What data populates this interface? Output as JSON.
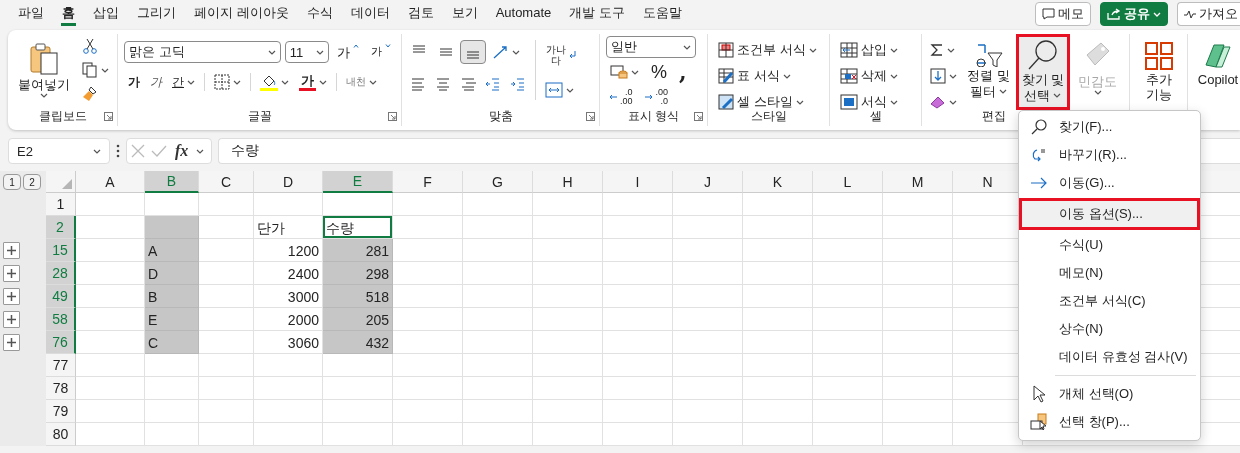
{
  "tabs": [
    {
      "label": "파일",
      "selected": false
    },
    {
      "label": "홈",
      "selected": true
    },
    {
      "label": "삽입",
      "selected": false
    },
    {
      "label": "그리기",
      "selected": false
    },
    {
      "label": "페이지 레이아웃",
      "selected": false
    },
    {
      "label": "수식",
      "selected": false
    },
    {
      "label": "데이터",
      "selected": false
    },
    {
      "label": "검토",
      "selected": false
    },
    {
      "label": "보기",
      "selected": false
    },
    {
      "label": "Automate",
      "selected": false
    },
    {
      "label": "개발 도구",
      "selected": false
    },
    {
      "label": "도움말",
      "selected": false
    }
  ],
  "header_buttons": [
    {
      "label": "메모",
      "kind": "comment"
    },
    {
      "label": "공유",
      "kind": "share"
    },
    {
      "label": "가져오",
      "kind": "import"
    }
  ],
  "ribbon": {
    "groups": [
      {
        "kind": "clipboard",
        "label": "클립보드",
        "paste": "붙여넣기"
      },
      {
        "kind": "font",
        "label": "글꼴",
        "font_name": "맑은 고딕",
        "font_size": "11",
        "grow": "가",
        "shrink": "가",
        "bold": "가",
        "italic": "가",
        "underline": "간",
        "font_color": "가",
        "phonetic": "내천"
      },
      {
        "kind": "alignment",
        "label": "맞춤",
        "vertical": [
          {
            "selected": false
          },
          {
            "selected": false
          },
          {
            "selected": true
          }
        ],
        "wrap": "가나다"
      },
      {
        "kind": "number",
        "label": "표시 형식",
        "format": "일반",
        "percent": "%",
        "comma": ",",
        "increase_decimal": [
          ".0",
          ".00"
        ],
        "decrease_decimal": [
          ".00",
          ".0"
        ]
      },
      {
        "kind": "styles",
        "label": "스타일",
        "items": [
          "조건부 서식",
          "표 서식",
          "셀 스타일"
        ]
      },
      {
        "kind": "cells",
        "label": "셀",
        "items": [
          "삽입",
          "삭제",
          "서식"
        ]
      },
      {
        "kind": "editing",
        "label": "편집",
        "sort": [
          "정렬 및",
          "필터"
        ],
        "find": [
          "찾기 및",
          "선택"
        ],
        "find_selected": true
      },
      {
        "kind": "sensitivity",
        "label": "민감도",
        "disabled": true
      },
      {
        "kind": "addins",
        "label": [
          "추가",
          "기능"
        ]
      },
      {
        "kind": "copilot",
        "label": "Copilot"
      }
    ]
  },
  "formula_bar": {
    "name_box": "E2",
    "fx": "fx",
    "formula": "수량"
  },
  "outline_levels": [
    "1",
    "2"
  ],
  "columns": [
    {
      "letter": "A",
      "selected": false,
      "active": false
    },
    {
      "letter": "B",
      "selected": true,
      "active": false
    },
    {
      "letter": "C",
      "selected": false,
      "active": false
    },
    {
      "letter": "D",
      "selected": false,
      "active": false
    },
    {
      "letter": "E",
      "selected": true,
      "active": true
    },
    {
      "letter": "F",
      "selected": false,
      "active": false
    },
    {
      "letter": "G",
      "selected": false,
      "active": false
    },
    {
      "letter": "H",
      "selected": false,
      "active": false
    },
    {
      "letter": "I",
      "selected": false,
      "active": false
    },
    {
      "letter": "J",
      "selected": false,
      "active": false
    },
    {
      "letter": "K",
      "selected": false,
      "active": false
    },
    {
      "letter": "L",
      "selected": false,
      "active": false
    },
    {
      "letter": "M",
      "selected": false,
      "active": false
    },
    {
      "letter": "N",
      "selected": false,
      "active": false
    }
  ],
  "rows": [
    {
      "header": "1",
      "selected": false,
      "active": false,
      "collapsed": false
    },
    {
      "header": "2",
      "selected": true,
      "active": true,
      "collapsed": false,
      "column_d": "단가",
      "column_e": "수량"
    },
    {
      "header": "15",
      "selected": true,
      "active": false,
      "collapsed": true,
      "column_b": "A",
      "column_d": "1200",
      "column_e": "281"
    },
    {
      "header": "28",
      "selected": true,
      "active": false,
      "collapsed": true,
      "column_b": "D",
      "column_d": "2400",
      "column_e": "298"
    },
    {
      "header": "49",
      "selected": true,
      "active": false,
      "collapsed": true,
      "column_b": "B",
      "column_d": "3000",
      "column_e": "518"
    },
    {
      "header": "58",
      "selected": true,
      "active": false,
      "collapsed": true,
      "column_b": "E",
      "column_d": "2000",
      "column_e": "205"
    },
    {
      "header": "76",
      "selected": true,
      "active": false,
      "collapsed": true,
      "column_b": "C",
      "column_d": "3060",
      "column_e": "432"
    },
    {
      "header": "77",
      "selected": false,
      "active": false,
      "collapsed": false
    },
    {
      "header": "78",
      "selected": false,
      "active": false,
      "collapsed": false
    },
    {
      "header": "79",
      "selected": false,
      "active": false,
      "collapsed": false
    },
    {
      "header": "80",
      "selected": false,
      "active": false,
      "collapsed": false
    }
  ],
  "menu": {
    "items": [
      {
        "label": "찾기(F)...",
        "selected": false
      },
      {
        "label": "바꾸기(R)...",
        "selected": false
      },
      {
        "label": "이동(G)...",
        "selected": false
      },
      {
        "label": "이동 옵션(S)...",
        "selected": true
      },
      {
        "label": "수식(U)",
        "selected": false
      },
      {
        "label": "메모(N)",
        "selected": false
      },
      {
        "label": "조건부 서식(C)",
        "selected": false
      },
      {
        "label": "상수(N)",
        "selected": false
      },
      {
        "label": "데이터 유효성 검사(V)",
        "selected": false
      },
      {
        "label": "개체 선택(O)",
        "selected": false,
        "divider_above": true
      },
      {
        "label": "선택 창(P)...",
        "selected": false
      }
    ]
  }
}
